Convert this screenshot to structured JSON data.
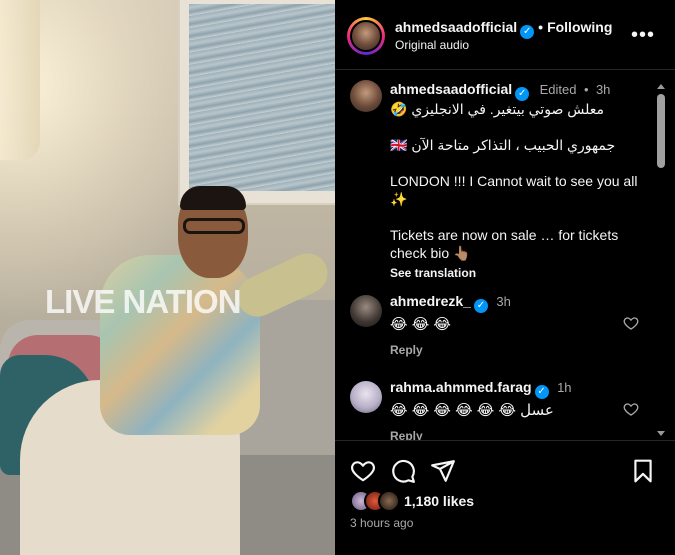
{
  "media": {
    "watermark": "LIVE NATION"
  },
  "post": {
    "username": "ahmedsaadofficial",
    "verified": true,
    "follow_status": "Following",
    "separator": "•",
    "audio": "Original audio",
    "more_icon": "more-horizontal-icon"
  },
  "caption": {
    "username": "ahmedsaadofficial",
    "edited": "Edited",
    "time": "3h",
    "lines": [
      "معلش صوتي بيتغير. في الانجليزي 🤣",
      "🇬🇧 جمهوري الحبيب ، التذاكر متاحة الآن",
      "LONDON !!! I Cannot wait to see you all ✨",
      "Tickets are now on sale … for tickets check bio 👆🏽"
    ],
    "see_translation": "See translation"
  },
  "comments": [
    {
      "username": "ahmedrezk_",
      "time": "3h",
      "text": "😂 😂 😂",
      "reply": "Reply"
    },
    {
      "username": "rahma.ahmmed.farag",
      "time": "1h",
      "text": "عسل 😂 😂 😂 😂 😂 😂",
      "reply": "Reply"
    }
  ],
  "footer": {
    "likes": "1,180 likes",
    "posted": "3 hours ago"
  },
  "colors": {
    "verified": "#0095f6",
    "text": "#f5f5f5",
    "muted": "#a8a8a8",
    "background": "#000000"
  }
}
